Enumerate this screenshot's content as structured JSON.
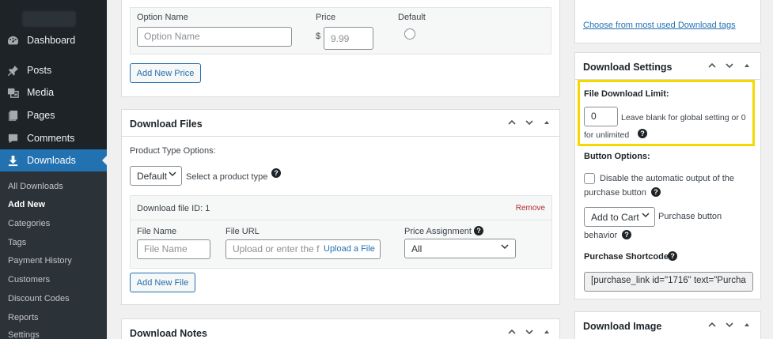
{
  "sidebar": {
    "menu": [
      {
        "label": "Dashboard",
        "icon": "dashboard-icon"
      },
      {
        "label": "Posts",
        "icon": "pin-icon"
      },
      {
        "label": "Media",
        "icon": "media-icon"
      },
      {
        "label": "Pages",
        "icon": "pages-icon"
      },
      {
        "label": "Comments",
        "icon": "comments-icon"
      },
      {
        "label": "Downloads",
        "icon": "download-icon"
      }
    ],
    "submenu": [
      "All Downloads",
      "Add New",
      "Categories",
      "Tags",
      "Payment History",
      "Customers",
      "Discount Codes",
      "Reports",
      "Settings"
    ]
  },
  "variable_pricing": {
    "option_name_label": "Option Name",
    "option_name_placeholder": "Option Name",
    "price_label": "Price",
    "currency": "$",
    "price_placeholder": "9.99",
    "default_label": "Default",
    "add_price_button": "Add New Price"
  },
  "download_files": {
    "title": "Download Files",
    "product_type_label": "Product Type Options:",
    "product_type_value": "Default",
    "product_type_hint": "Select a product type",
    "file_header": "Download file ID: 1",
    "remove_label": "Remove",
    "file_name_label": "File Name",
    "file_name_placeholder": "File Name",
    "file_url_label": "File URL",
    "file_url_placeholder": "Upload or enter the f",
    "upload_button": "Upload a File",
    "price_assignment_label": "Price Assignment",
    "price_assignment_value": "All",
    "add_file_button": "Add New File"
  },
  "download_notes": {
    "title": "Download Notes"
  },
  "tags": {
    "most_used_link": "Choose from most used Download tags"
  },
  "download_settings": {
    "title": "Download Settings",
    "file_limit_label": "File Download Limit:",
    "file_limit_value": "0",
    "file_limit_hint_1": "Leave blank for global setting or 0",
    "file_limit_hint_2": "for unlimited",
    "button_options_label": "Button Options:",
    "disable_output_1": "Disable the automatic output of the",
    "disable_output_2": "purchase button",
    "button_behavior_value": "Add to Cart",
    "button_behavior_hint_1": "Purchase button",
    "button_behavior_hint_2": "behavior",
    "shortcode_label": "Purchase Shortcode:",
    "shortcode_value": "[purchase_link id=\"1716\" text=\"Purcha"
  },
  "download_image": {
    "title": "Download Image"
  },
  "colors": {
    "highlight": "#f5d800",
    "accent": "#2271b1",
    "sidebar": "#1d2327"
  }
}
